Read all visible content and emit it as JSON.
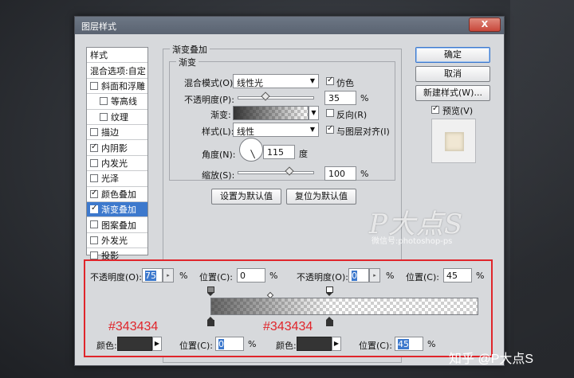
{
  "window": {
    "title": "图层样式",
    "close_label": "X"
  },
  "styles_panel": {
    "items": [
      {
        "label": "样式",
        "checkbox": false,
        "checked": false,
        "indent": false,
        "selected": false
      },
      {
        "label": "混合选项:自定",
        "checkbox": false,
        "checked": false,
        "indent": false,
        "selected": false
      },
      {
        "label": "斜面和浮雕",
        "checkbox": true,
        "checked": false,
        "indent": false,
        "selected": false
      },
      {
        "label": "等高线",
        "checkbox": true,
        "checked": false,
        "indent": true,
        "selected": false
      },
      {
        "label": "纹理",
        "checkbox": true,
        "checked": false,
        "indent": true,
        "selected": false
      },
      {
        "label": "描边",
        "checkbox": true,
        "checked": false,
        "indent": false,
        "selected": false
      },
      {
        "label": "内阴影",
        "checkbox": true,
        "checked": true,
        "indent": false,
        "selected": false
      },
      {
        "label": "内发光",
        "checkbox": true,
        "checked": false,
        "indent": false,
        "selected": false
      },
      {
        "label": "光泽",
        "checkbox": true,
        "checked": false,
        "indent": false,
        "selected": false
      },
      {
        "label": "颜色叠加",
        "checkbox": true,
        "checked": true,
        "indent": false,
        "selected": false
      },
      {
        "label": "渐变叠加",
        "checkbox": true,
        "checked": true,
        "indent": false,
        "selected": true
      },
      {
        "label": "图案叠加",
        "checkbox": true,
        "checked": false,
        "indent": false,
        "selected": false
      },
      {
        "label": "外发光",
        "checkbox": true,
        "checked": false,
        "indent": false,
        "selected": false
      },
      {
        "label": "投影",
        "checkbox": true,
        "checked": false,
        "indent": false,
        "selected": false
      }
    ]
  },
  "gradient_overlay": {
    "section_title": "渐变叠加",
    "group_title": "渐变",
    "blend_mode_label": "混合模式(O):",
    "blend_mode_value": "线性光",
    "dither_label": "仿色",
    "dither_checked": true,
    "opacity_label": "不透明度(P):",
    "opacity_value": "35",
    "opacity_unit": "%",
    "opacity_level": 0.35,
    "gradient_label": "渐变:",
    "reverse_label": "反向(R)",
    "reverse_checked": false,
    "style_label": "样式(L):",
    "style_value": "线性",
    "align_label": "与图层对齐(I)",
    "align_checked": true,
    "angle_label": "角度(N):",
    "angle_value": "115",
    "angle_unit": "度",
    "scale_label": "缩放(S):",
    "scale_value": "100",
    "scale_unit": "%",
    "scale_level": 0.67,
    "set_default_label": "设置为默认值",
    "reset_default_label": "复位为默认值"
  },
  "buttons": {
    "ok": "确定",
    "cancel": "取消",
    "new_style": "新建样式(W)...",
    "preview_label": "预览(V)",
    "preview_checked": true
  },
  "gradient_editor": {
    "left_opacity_label": "不透明度(O):",
    "left_opacity_value": "75",
    "left_opacity_unit": "%",
    "left_position_label": "位置(C):",
    "left_position_value": "0",
    "left_position_unit": "%",
    "right_opacity_label": "不透明度(O):",
    "right_opacity_value": "0",
    "right_opacity_unit": "%",
    "right_position_label": "位置(C):",
    "right_position_value": "45",
    "right_position_unit": "%",
    "color_label_1": "颜色:",
    "color_position_label_1": "位置(C):",
    "color_position_value_1": "0",
    "color_position_unit_1": "%",
    "color_label_2": "颜色:",
    "color_position_label_2": "位置(C):",
    "color_position_value_2": "45",
    "color_position_unit_2": "%",
    "annotation_1": "#343434",
    "annotation_2": "#343434",
    "stop_color": "#343434"
  },
  "watermark": {
    "logo": "P大点S",
    "sub": "微信号:photoshop-ps",
    "zhihu": "知乎 @P大点S"
  },
  "colors": {
    "accent": "#3d79cd",
    "annotation": "#e0252b",
    "stop": "#343434"
  }
}
